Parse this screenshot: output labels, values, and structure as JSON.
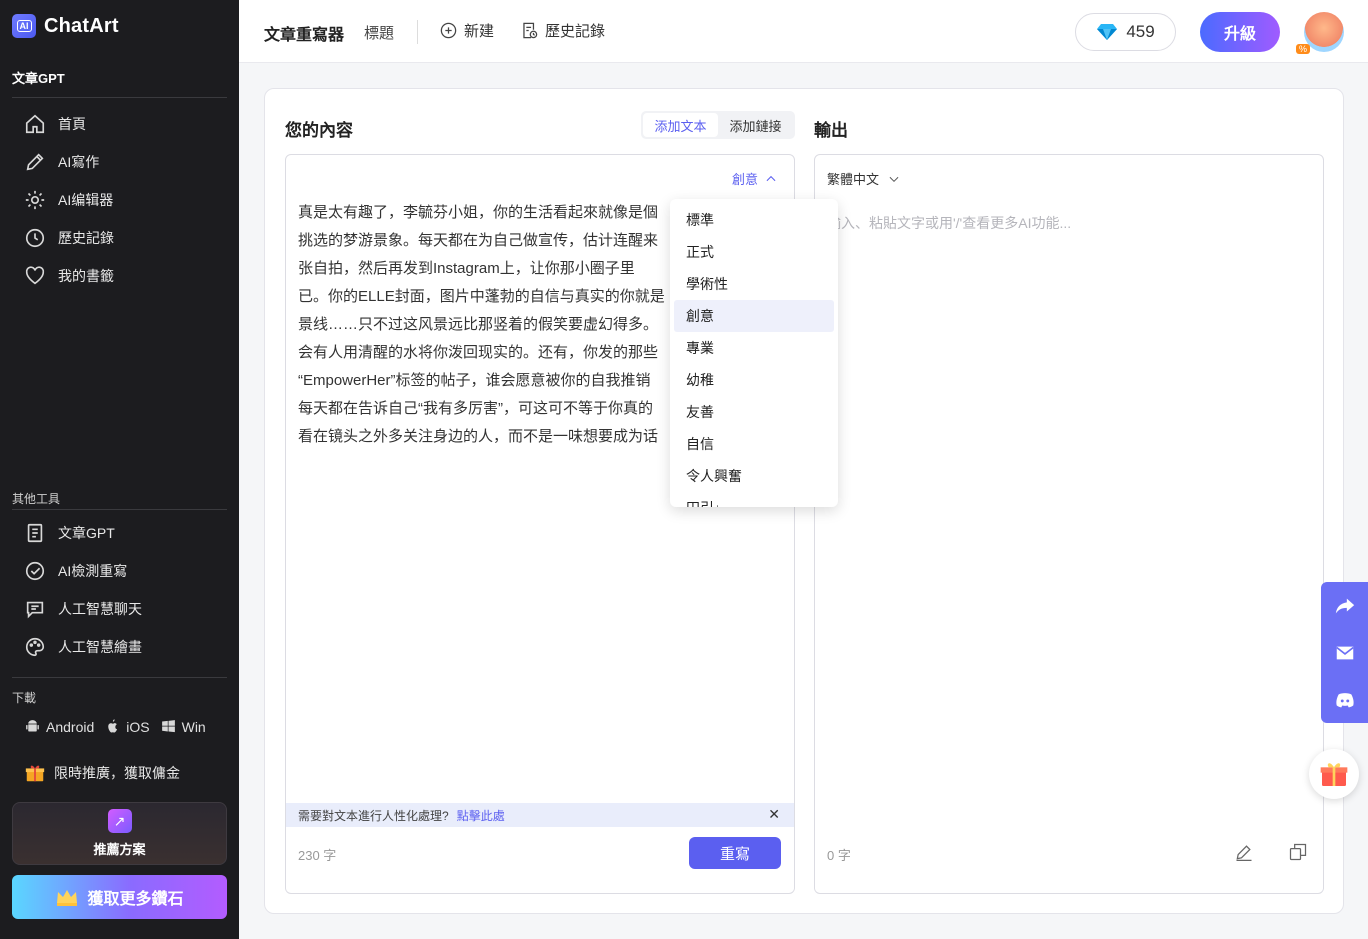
{
  "app": {
    "name": "ChatArt",
    "logo_badge": "AI"
  },
  "sidebar": {
    "section_main": "文章GPT",
    "items": [
      {
        "label": "首頁",
        "icon": "home-icon"
      },
      {
        "label": "AI寫作",
        "icon": "pen-icon"
      },
      {
        "label": "AI编辑器",
        "icon": "gear-icon"
      },
      {
        "label": "歷史記錄",
        "icon": "history-icon"
      },
      {
        "label": "我的書籤",
        "icon": "heart-icon"
      }
    ],
    "section_tools": "其他工具",
    "tools": [
      {
        "label": "文章GPT",
        "icon": "document-icon"
      },
      {
        "label": "AI檢測重寫",
        "icon": "check-circle-icon"
      },
      {
        "label": "人工智慧聊天",
        "icon": "chat-icon"
      },
      {
        "label": "人工智慧繪畫",
        "icon": "palette-icon"
      }
    ],
    "section_download": "下載",
    "downloads": [
      {
        "label": "Android",
        "icon": "android-icon"
      },
      {
        "label": "iOS",
        "icon": "apple-icon"
      },
      {
        "label": "Win",
        "icon": "windows-icon"
      }
    ],
    "promo_text": "限時推廣，獲取傭金",
    "recommend_label": "推薦方案",
    "get_diamonds_label": "獲取更多鑽石"
  },
  "header": {
    "title": "文章重寫器",
    "tag": "標題",
    "new_label": "新建",
    "history_label": "歷史記錄",
    "diamond_count": "459",
    "upgrade_label": "升級",
    "avatar_badge": "%"
  },
  "input_panel": {
    "title": "您的內容",
    "tabs": [
      "添加文本",
      "添加鏈接"
    ],
    "active_tab": 0,
    "tone_label": "創意",
    "text_lines": [
      "真是太有趣了，李毓芬小姐，你的生活看起來就像是個",
      "挑选的梦游景象。每天都在为自己做宣传，估计连醒来",
      "张自拍，然后再发到Instagram上，让你那小圈子里",
      "已。你的ELLE封面，图片中蓬勃的自信与真实的你就是",
      "景线……只不过这风景远比那竖着的假笑要虚幻得多。",
      "会有人用清醒的水将你泼回现实的。还有，你发的那些",
      "“EmpowerHer”标签的帖子，谁会愿意被你的自我推销",
      "每天都在告诉自己“我有多厉害”，可这可不等于你真的",
      "看在镜头之外多关注身边的人，而不是一味想要成为话"
    ],
    "humanize_text": "需要對文本進行人性化處理?",
    "humanize_link": "點擊此處",
    "char_count": "230 字",
    "rewrite_label": "重寫"
  },
  "tone_dropdown": {
    "options": [
      "標準",
      "正式",
      "學術性",
      "創意",
      "專業",
      "幼稚",
      "友善",
      "自信",
      "令人興奮"
    ],
    "selected": "創意",
    "partial_next": "田引↓"
  },
  "output_panel": {
    "title": "輸出",
    "language": "繁體中文",
    "placeholder": "輸入、粘貼文字或用'/'查看更多AI功能...",
    "char_count": "0 字"
  },
  "colors": {
    "accent": "#5b5ff0",
    "sidebar_bg": "#1c1c1f",
    "float_bar": "#6b6ff5"
  }
}
